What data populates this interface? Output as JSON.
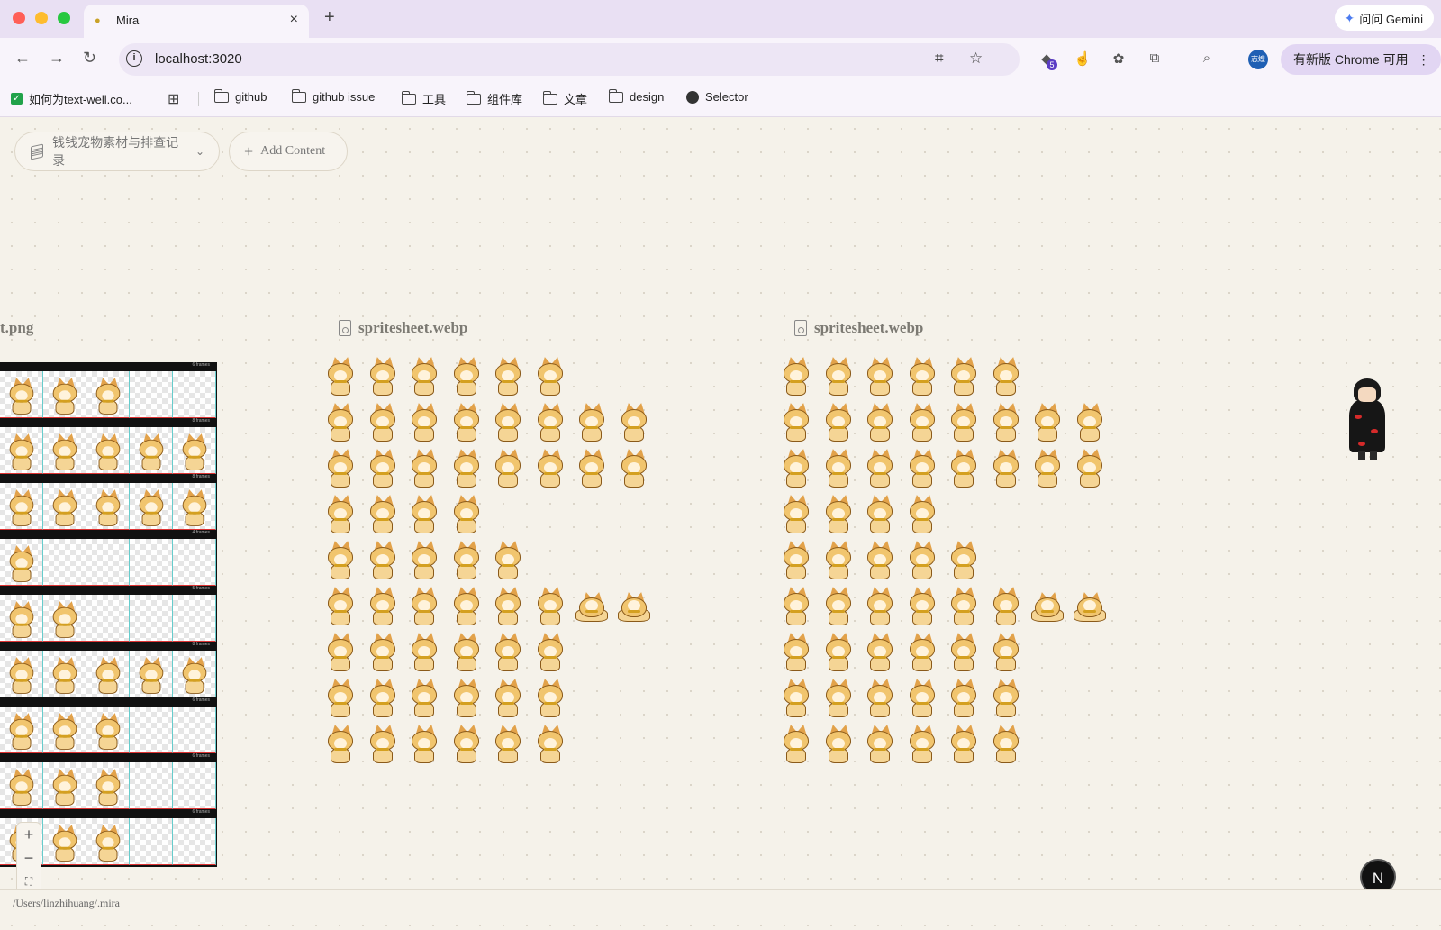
{
  "browser": {
    "tab_title": "Mira",
    "new_tab": "+",
    "close": "×",
    "gemini_label": "问问 Gemini",
    "url": "localhost:3020",
    "update_label": "有新版 Chrome 可用",
    "ext_badge": "5",
    "profile_text": "志煌"
  },
  "bookmarks": [
    {
      "label": "如何为text-well.co..."
    },
    {
      "label": "github"
    },
    {
      "label": "github issue"
    },
    {
      "label": "工具"
    },
    {
      "label": "组件库"
    },
    {
      "label": "文章"
    },
    {
      "label": "design"
    },
    {
      "label": "Selector"
    }
  ],
  "app": {
    "project_name": "钱钱宠物素材与排查记录",
    "add_content": "Add Content",
    "file_left": "t.png",
    "file_middle": "spritesheet.webp",
    "file_right": "spritesheet.webp",
    "status_path": "/Users/linzhihuang/.mira",
    "n_button": "N",
    "zoom_in": "+",
    "zoom_out": "−",
    "fit": "⛶"
  },
  "sprite_sheet": {
    "row_counts": [
      6,
      8,
      8,
      4,
      5,
      8,
      6,
      6,
      6
    ],
    "png_rows": [
      {
        "header": "6 frames",
        "filled": 3
      },
      {
        "header": "8 frames",
        "filled": 5
      },
      {
        "header": "8 frames",
        "filled": 5
      },
      {
        "header": "4 frames",
        "filled": 1
      },
      {
        "header": "5 frames",
        "filled": 2
      },
      {
        "header": "8 frames",
        "filled": 5
      },
      {
        "header": "6 frames",
        "filled": 3
      },
      {
        "header": "6 frames",
        "filled": 3
      },
      {
        "header": "6 frames",
        "filled": 3
      }
    ]
  }
}
